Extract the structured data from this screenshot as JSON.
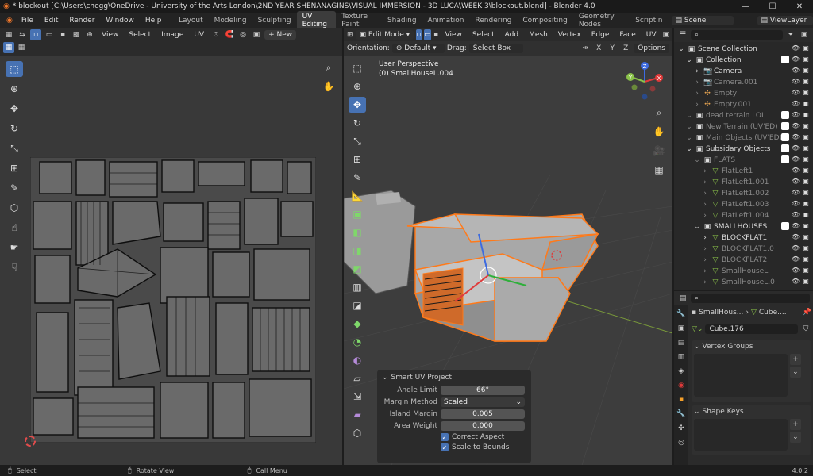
{
  "titlebar": {
    "title": "* blockout [C:\\Users\\chegg\\OneDrive - University of the Arts London\\2ND YEAR SHENANAGINS\\VISUAL IMMERSION - 3D LUCA\\WEEK 3\\blockout.blend] - Blender 4.0",
    "min": "—",
    "max": "☐",
    "close": "✕"
  },
  "menubar": {
    "items": [
      "File",
      "Edit",
      "Render",
      "Window",
      "Help"
    ],
    "workspaces": [
      "Layout",
      "Modeling",
      "Sculpting",
      "UV Editing",
      "Texture Paint",
      "Shading",
      "Animation",
      "Rendering",
      "Compositing",
      "Geometry Nodes",
      "Scriptin"
    ],
    "active_workspace": "UV Editing",
    "scene": "Scene",
    "viewlayer": "ViewLayer"
  },
  "uv_header": {
    "menus": [
      "View",
      "Select",
      "Image",
      "UV"
    ],
    "new_label": "+ New"
  },
  "vp_header": {
    "mode": "Edit Mode",
    "menus": [
      "View",
      "Select",
      "Add",
      "Mesh",
      "Vertex",
      "Edge",
      "Face",
      "UV"
    ],
    "orientation_label": "Orientation:",
    "orientation": "Default",
    "drag_label": "Drag:",
    "drag": "Select Box",
    "axes": [
      "X",
      "Y",
      "Z"
    ],
    "options": "Options"
  },
  "viewport": {
    "perspective": "User Perspective",
    "object": "(0) SmallHouseL.004",
    "gizmo": {
      "x": "X",
      "y": "Y",
      "z": "Z"
    }
  },
  "outliner": {
    "search_placeholder": "",
    "rows": [
      {
        "label": "Scene Collection",
        "indent": 0,
        "icon": "▣",
        "dim": false,
        "check": false
      },
      {
        "label": "Collection",
        "indent": 1,
        "icon": "▣",
        "dim": false,
        "check": true
      },
      {
        "label": "Camera",
        "indent": 2,
        "icon": "📷",
        "dim": false,
        "check": false
      },
      {
        "label": "Camera.001",
        "indent": 2,
        "icon": "📷",
        "dim": true,
        "check": false
      },
      {
        "label": "Empty",
        "indent": 2,
        "icon": "✣",
        "dim": true,
        "check": false
      },
      {
        "label": "Empty.001",
        "indent": 2,
        "icon": "✣",
        "dim": true,
        "check": false
      },
      {
        "label": "dead terrain LOL",
        "indent": 1,
        "icon": "▣",
        "dim": true,
        "check": true
      },
      {
        "label": "New Terrain (UV'ED)",
        "indent": 1,
        "icon": "▣",
        "dim": true,
        "check": true
      },
      {
        "label": "Main Objects (UV'ED)",
        "indent": 1,
        "icon": "▣",
        "dim": true,
        "check": true
      },
      {
        "label": "Subsidary Objects",
        "indent": 1,
        "icon": "▣",
        "dim": false,
        "check": true
      },
      {
        "label": "FLATS",
        "indent": 2,
        "icon": "▣",
        "dim": true,
        "check": true
      },
      {
        "label": "FlatLeft1",
        "indent": 3,
        "icon": "▽",
        "dim": true,
        "check": false
      },
      {
        "label": "FlatLeft1.001",
        "indent": 3,
        "icon": "▽",
        "dim": true,
        "check": false
      },
      {
        "label": "FlatLeft1.002",
        "indent": 3,
        "icon": "▽",
        "dim": true,
        "check": false
      },
      {
        "label": "FlatLeft1.003",
        "indent": 3,
        "icon": "▽",
        "dim": true,
        "check": false
      },
      {
        "label": "FlatLeft1.004",
        "indent": 3,
        "icon": "▽",
        "dim": true,
        "check": false
      },
      {
        "label": "SMALLHOUSES",
        "indent": 2,
        "icon": "▣",
        "dim": false,
        "check": true
      },
      {
        "label": "BLOCKFLAT1",
        "indent": 3,
        "icon": "▽",
        "dim": false,
        "check": false
      },
      {
        "label": "BLOCKFLAT1.0",
        "indent": 3,
        "icon": "▽",
        "dim": true,
        "check": false
      },
      {
        "label": "BLOCKFLAT2",
        "indent": 3,
        "icon": "▽",
        "dim": true,
        "check": false
      },
      {
        "label": "SmallHouseL",
        "indent": 3,
        "icon": "▽",
        "dim": true,
        "check": false
      },
      {
        "label": "SmallHouseL.0",
        "indent": 3,
        "icon": "▽",
        "dim": true,
        "check": false
      }
    ]
  },
  "properties": {
    "breadcrumb_a": "SmallHous...",
    "breadcrumb_b": "Cube....",
    "mesh_name": "Cube.176",
    "vertex_groups": "Vertex Groups",
    "shape_keys": "Shape Keys"
  },
  "smart_uv": {
    "title": "Smart UV Project",
    "angle_limit_label": "Angle Limit",
    "angle_limit": "66°",
    "margin_method_label": "Margin Method",
    "margin_method": "Scaled",
    "island_margin_label": "Island Margin",
    "island_margin": "0.005",
    "area_weight_label": "Area Weight",
    "area_weight": "0.000",
    "correct_aspect": "Correct Aspect",
    "scale_to_bounds": "Scale to Bounds"
  },
  "status": {
    "select": "Select",
    "rotate": "Rotate View",
    "call_menu": "Call Menu",
    "version": "4.0.2"
  },
  "colors": {
    "accent": "#4772b3",
    "selection": "#ff7a1a",
    "bg": "#1d1d1d"
  }
}
